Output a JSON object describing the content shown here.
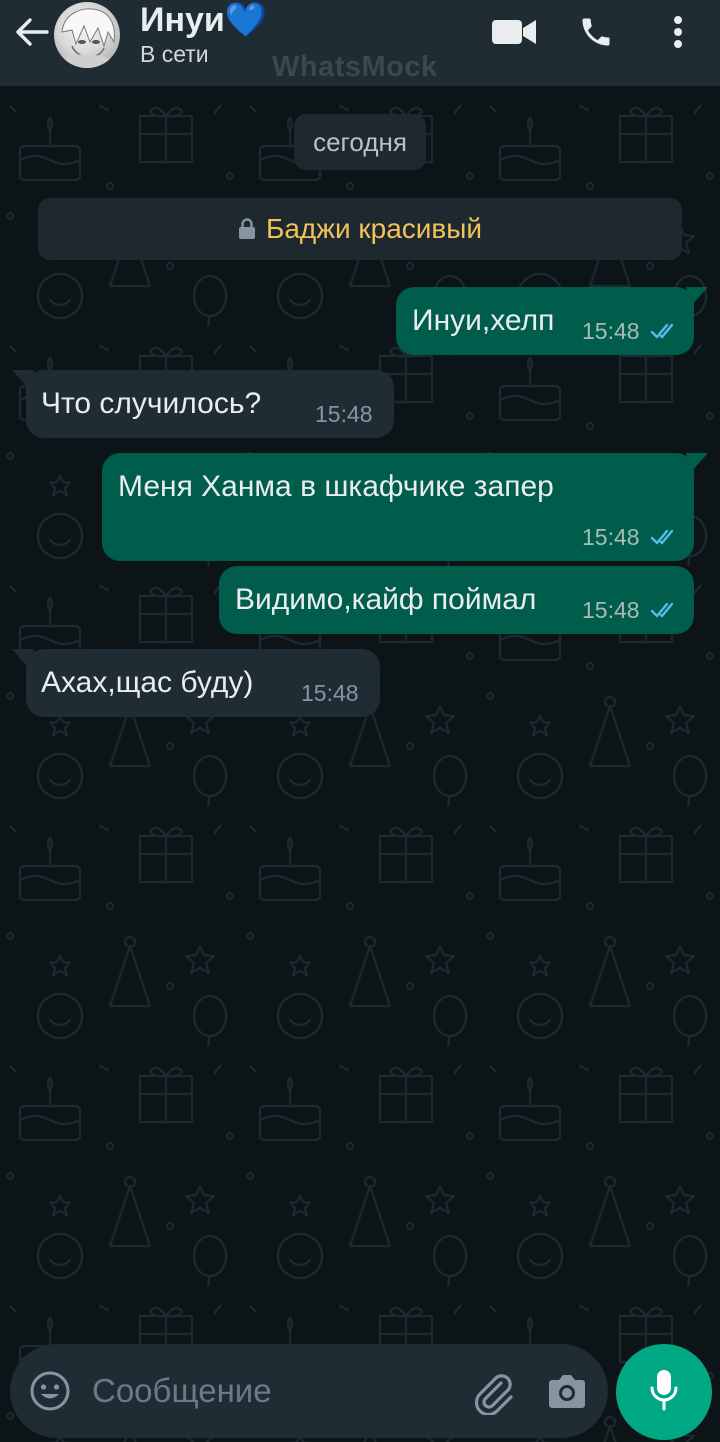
{
  "header": {
    "contact_name": "Инуи💙",
    "status": "В сети",
    "watermark": "WhatsMock",
    "icons": [
      "back-arrow-icon",
      "video-call-icon",
      "phone-icon",
      "more-vert-icon"
    ]
  },
  "chat": {
    "date_divider": "сегодня",
    "system_message": "Баджи красивый",
    "messages": [
      {
        "direction": "out",
        "text": "Инуи,хелп",
        "time": "15:48",
        "status": "read"
      },
      {
        "direction": "in",
        "text": "Что случилось?",
        "time": "15:48"
      },
      {
        "direction": "out",
        "text": "Меня Ханма в шкафчике запер",
        "time": "15:48",
        "status": "read"
      },
      {
        "direction": "out",
        "text": "Видимо,кайф поймал",
        "time": "15:48",
        "status": "read"
      },
      {
        "direction": "in",
        "text": "Ахах,щас буду)",
        "time": "15:48"
      }
    ]
  },
  "composer": {
    "placeholder": "Сообщение",
    "value": "",
    "icons": [
      "emoji-icon",
      "attach-icon",
      "camera-icon",
      "mic-icon"
    ]
  },
  "colors": {
    "header_bg": "#1f2c34",
    "chat_bg": "#0d1418",
    "outgoing_bubble": "#005c4b",
    "incoming_bubble": "#1f2c34",
    "accent": "#00a884",
    "read_ticks": "#53bdeb",
    "system_text": "#f1c25a"
  }
}
